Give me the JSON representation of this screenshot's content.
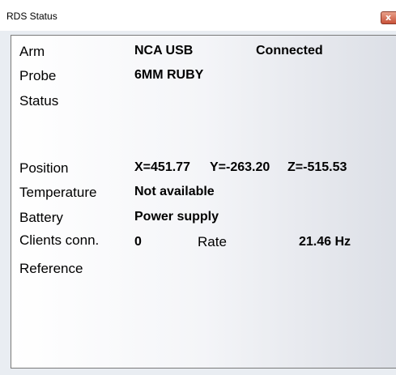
{
  "window": {
    "title": "RDS Status",
    "close_glyph": "x"
  },
  "fields": {
    "arm": {
      "label": "Arm",
      "value": "NCA USB",
      "state": "Connected"
    },
    "probe": {
      "label": "Probe",
      "value": "6MM RUBY"
    },
    "status": {
      "label": "Status",
      "value": ""
    },
    "position": {
      "label": "Position",
      "x": "X=451.77",
      "y": "Y=-263.20",
      "z": "Z=-515.53"
    },
    "temperature": {
      "label": "Temperature",
      "value": "Not available"
    },
    "battery": {
      "label": "Battery",
      "value": "Power supply"
    },
    "clients": {
      "label": "Clients conn.",
      "value": "0",
      "rate_label": "Rate",
      "rate_value": "21.46 Hz"
    },
    "reference": {
      "label": "Reference",
      "value": ""
    }
  },
  "colors": {
    "close_button": "#c8523a",
    "panel_border": "#7a7a7a"
  }
}
